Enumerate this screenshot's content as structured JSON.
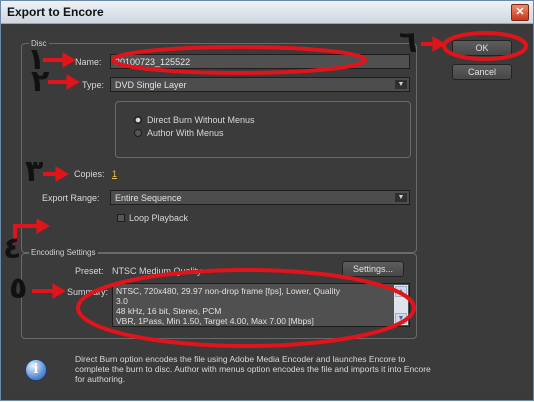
{
  "window": {
    "title": "Export to Encore",
    "close_icon": "close-icon"
  },
  "disc": {
    "group_label": "Disc",
    "name_label": "Name:",
    "name_value": "20100723_125522",
    "type_label": "Type:",
    "type_value": "DVD Single Layer",
    "option_direct_burn": "Direct Burn Without Menus",
    "option_author": "Author With Menus",
    "copies_label": "Copies:",
    "copies_value": "1",
    "export_range_label": "Export Range:",
    "export_range_value": "Entire Sequence",
    "loop_label": "Loop Playback"
  },
  "encoding": {
    "group_label": "Encoding Settings",
    "preset_label": "Preset:",
    "preset_value": "NTSC Medium Quality",
    "settings_button": "Settings...",
    "summary_label": "Summary:",
    "summary_lines": [
      "NTSC, 720x480, 29.97 non-drop frame [fps], Lower, Quality",
      "3.0",
      "48 kHz, 16 bit, Stereo, PCM",
      "VBR, 1Pass, Min 1.50, Target 4.00, Max 7.00 [Mbps]"
    ]
  },
  "buttons": {
    "ok": "OK",
    "cancel": "Cancel"
  },
  "info": {
    "icon": "info-icon",
    "text": "Direct Burn option encodes the file using Adobe Media Encoder and launches Encore to complete the burn to disc. Author with menus option encodes the file and imports it into Encore for authoring."
  },
  "annotations": {
    "digits": [
      "١",
      "٢",
      "٣",
      "٤",
      "٥",
      "٦"
    ],
    "color": "#e0141a"
  }
}
